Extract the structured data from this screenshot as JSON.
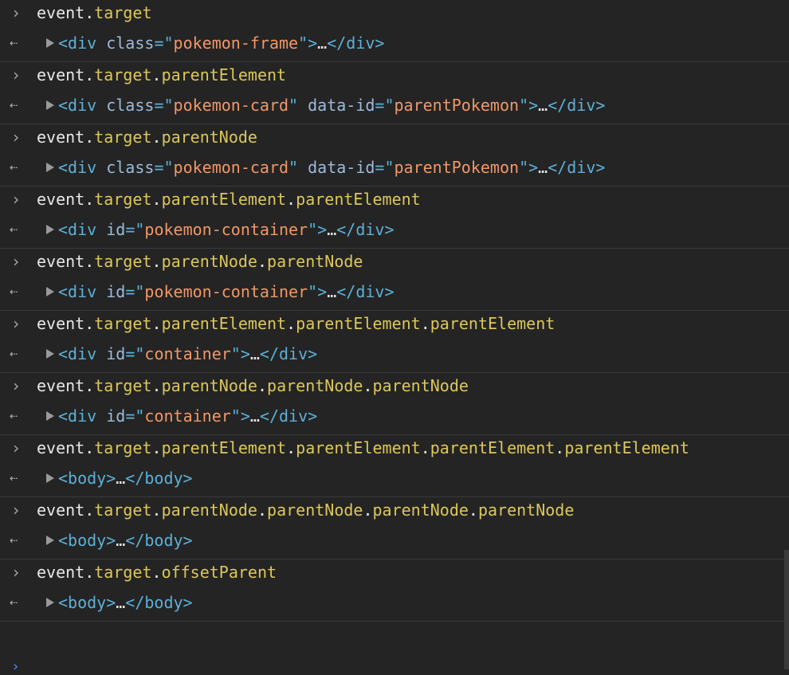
{
  "entries": [
    {
      "command": [
        {
          "t": "obj",
          "s": "event"
        },
        {
          "t": "dot",
          "s": "."
        },
        {
          "t": "prop",
          "s": "target"
        }
      ],
      "result": [
        {
          "t": "tag",
          "s": "<div "
        },
        {
          "t": "attr",
          "s": "class"
        },
        {
          "t": "tag",
          "s": "=\""
        },
        {
          "t": "val",
          "s": "pokemon-frame"
        },
        {
          "t": "tag",
          "s": "\">"
        },
        {
          "t": "ell",
          "s": "…"
        },
        {
          "t": "tag",
          "s": "</div>"
        }
      ]
    },
    {
      "command": [
        {
          "t": "obj",
          "s": "event"
        },
        {
          "t": "dot",
          "s": "."
        },
        {
          "t": "prop",
          "s": "target"
        },
        {
          "t": "dot",
          "s": "."
        },
        {
          "t": "prop",
          "s": "parentElement"
        }
      ],
      "result": [
        {
          "t": "tag",
          "s": "<div "
        },
        {
          "t": "attr",
          "s": "class"
        },
        {
          "t": "tag",
          "s": "=\""
        },
        {
          "t": "val",
          "s": "pokemon-card"
        },
        {
          "t": "tag",
          "s": "\" "
        },
        {
          "t": "attr",
          "s": "data-id"
        },
        {
          "t": "tag",
          "s": "=\""
        },
        {
          "t": "val",
          "s": "parentPokemon"
        },
        {
          "t": "tag",
          "s": "\">"
        },
        {
          "t": "ell",
          "s": "…"
        },
        {
          "t": "tag",
          "s": "</div>"
        }
      ]
    },
    {
      "command": [
        {
          "t": "obj",
          "s": "event"
        },
        {
          "t": "dot",
          "s": "."
        },
        {
          "t": "prop",
          "s": "target"
        },
        {
          "t": "dot",
          "s": "."
        },
        {
          "t": "prop",
          "s": "parentNode"
        }
      ],
      "result": [
        {
          "t": "tag",
          "s": "<div "
        },
        {
          "t": "attr",
          "s": "class"
        },
        {
          "t": "tag",
          "s": "=\""
        },
        {
          "t": "val",
          "s": "pokemon-card"
        },
        {
          "t": "tag",
          "s": "\" "
        },
        {
          "t": "attr",
          "s": "data-id"
        },
        {
          "t": "tag",
          "s": "=\""
        },
        {
          "t": "val",
          "s": "parentPokemon"
        },
        {
          "t": "tag",
          "s": "\">"
        },
        {
          "t": "ell",
          "s": "…"
        },
        {
          "t": "tag",
          "s": "</div>"
        }
      ]
    },
    {
      "command": [
        {
          "t": "obj",
          "s": "event"
        },
        {
          "t": "dot",
          "s": "."
        },
        {
          "t": "prop",
          "s": "target"
        },
        {
          "t": "dot",
          "s": "."
        },
        {
          "t": "prop",
          "s": "parentElement"
        },
        {
          "t": "dot",
          "s": "."
        },
        {
          "t": "prop",
          "s": "parentElement"
        }
      ],
      "result": [
        {
          "t": "tag",
          "s": "<div "
        },
        {
          "t": "attr",
          "s": "id"
        },
        {
          "t": "tag",
          "s": "=\""
        },
        {
          "t": "val",
          "s": "pokemon-container"
        },
        {
          "t": "tag",
          "s": "\">"
        },
        {
          "t": "ell",
          "s": "…"
        },
        {
          "t": "tag",
          "s": "</div>"
        }
      ]
    },
    {
      "command": [
        {
          "t": "obj",
          "s": "event"
        },
        {
          "t": "dot",
          "s": "."
        },
        {
          "t": "prop",
          "s": "target"
        },
        {
          "t": "dot",
          "s": "."
        },
        {
          "t": "prop",
          "s": "parentNode"
        },
        {
          "t": "dot",
          "s": "."
        },
        {
          "t": "prop",
          "s": "parentNode"
        }
      ],
      "result": [
        {
          "t": "tag",
          "s": "<div "
        },
        {
          "t": "attr",
          "s": "id"
        },
        {
          "t": "tag",
          "s": "=\""
        },
        {
          "t": "val",
          "s": "pokemon-container"
        },
        {
          "t": "tag",
          "s": "\">"
        },
        {
          "t": "ell",
          "s": "…"
        },
        {
          "t": "tag",
          "s": "</div>"
        }
      ]
    },
    {
      "command": [
        {
          "t": "obj",
          "s": "event"
        },
        {
          "t": "dot",
          "s": "."
        },
        {
          "t": "prop",
          "s": "target"
        },
        {
          "t": "dot",
          "s": "."
        },
        {
          "t": "prop",
          "s": "parentElement"
        },
        {
          "t": "dot",
          "s": "."
        },
        {
          "t": "prop",
          "s": "parentElement"
        },
        {
          "t": "dot",
          "s": "."
        },
        {
          "t": "prop",
          "s": "parentElement"
        }
      ],
      "result": [
        {
          "t": "tag",
          "s": "<div "
        },
        {
          "t": "attr",
          "s": "id"
        },
        {
          "t": "tag",
          "s": "=\""
        },
        {
          "t": "val",
          "s": "container"
        },
        {
          "t": "tag",
          "s": "\">"
        },
        {
          "t": "ell",
          "s": "…"
        },
        {
          "t": "tag",
          "s": "</div>"
        }
      ]
    },
    {
      "command": [
        {
          "t": "obj",
          "s": "event"
        },
        {
          "t": "dot",
          "s": "."
        },
        {
          "t": "prop",
          "s": "target"
        },
        {
          "t": "dot",
          "s": "."
        },
        {
          "t": "prop",
          "s": "parentNode"
        },
        {
          "t": "dot",
          "s": "."
        },
        {
          "t": "prop",
          "s": "parentNode"
        },
        {
          "t": "dot",
          "s": "."
        },
        {
          "t": "prop",
          "s": "parentNode"
        }
      ],
      "result": [
        {
          "t": "tag",
          "s": "<div "
        },
        {
          "t": "attr",
          "s": "id"
        },
        {
          "t": "tag",
          "s": "=\""
        },
        {
          "t": "val",
          "s": "container"
        },
        {
          "t": "tag",
          "s": "\">"
        },
        {
          "t": "ell",
          "s": "…"
        },
        {
          "t": "tag",
          "s": "</div>"
        }
      ]
    },
    {
      "command": [
        {
          "t": "obj",
          "s": "event"
        },
        {
          "t": "dot",
          "s": "."
        },
        {
          "t": "prop",
          "s": "target"
        },
        {
          "t": "dot",
          "s": "."
        },
        {
          "t": "prop",
          "s": "parentElement"
        },
        {
          "t": "dot",
          "s": "."
        },
        {
          "t": "prop",
          "s": "parentElement"
        },
        {
          "t": "dot",
          "s": "."
        },
        {
          "t": "prop",
          "s": "parentElement"
        },
        {
          "t": "dot",
          "s": "."
        },
        {
          "t": "prop",
          "s": "parentElement"
        }
      ],
      "result": [
        {
          "t": "tag",
          "s": "<body>"
        },
        {
          "t": "ell",
          "s": "…"
        },
        {
          "t": "tag",
          "s": "</body>"
        }
      ]
    },
    {
      "command": [
        {
          "t": "obj",
          "s": "event"
        },
        {
          "t": "dot",
          "s": "."
        },
        {
          "t": "prop",
          "s": "target"
        },
        {
          "t": "dot",
          "s": "."
        },
        {
          "t": "prop",
          "s": "parentNode"
        },
        {
          "t": "dot",
          "s": "."
        },
        {
          "t": "prop",
          "s": "parentNode"
        },
        {
          "t": "dot",
          "s": "."
        },
        {
          "t": "prop",
          "s": "parentNode"
        },
        {
          "t": "dot",
          "s": "."
        },
        {
          "t": "prop",
          "s": "parentNode"
        }
      ],
      "result": [
        {
          "t": "tag",
          "s": "<body>"
        },
        {
          "t": "ell",
          "s": "…"
        },
        {
          "t": "tag",
          "s": "</body>"
        }
      ]
    },
    {
      "command": [
        {
          "t": "obj",
          "s": "event"
        },
        {
          "t": "dot",
          "s": "."
        },
        {
          "t": "prop",
          "s": "target"
        },
        {
          "t": "dot",
          "s": "."
        },
        {
          "t": "prop",
          "s": "offsetParent"
        }
      ],
      "result": [
        {
          "t": "tag",
          "s": "<body>"
        },
        {
          "t": "ell",
          "s": "…"
        },
        {
          "t": "tag",
          "s": "</body>"
        }
      ]
    }
  ],
  "icons": {
    "input_prompt": "chevron-right-icon",
    "result_marker": "return-arrow-icon",
    "expand": "disclosure-triangle-icon",
    "active_prompt": "chevron-right-icon"
  },
  "colors": {
    "background": "#242424",
    "divider": "#3a3a3a",
    "property": "#dcc85a",
    "tag": "#5db0d7",
    "attribute": "#9bbbdc",
    "attribute_value": "#f29766",
    "text": "#e8e8e8",
    "active_prompt": "#4a8df0"
  }
}
